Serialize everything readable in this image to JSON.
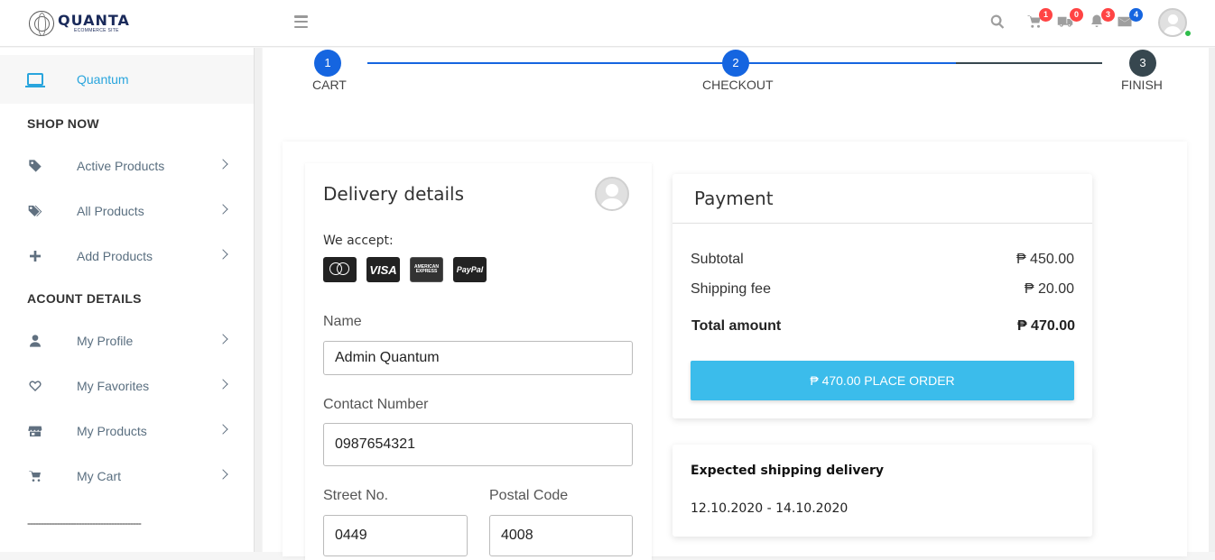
{
  "brand": {
    "name": "QUANTA",
    "tagline": "ECOMMERCE SITE"
  },
  "header": {
    "icons": [
      {
        "name": "search-icon",
        "badge": ""
      },
      {
        "name": "cart-icon",
        "badge": "1"
      },
      {
        "name": "truck-icon",
        "badge": "0"
      },
      {
        "name": "bell-icon",
        "badge": "3"
      },
      {
        "name": "mail-icon",
        "badge": "4"
      }
    ]
  },
  "sidebar": {
    "brand_label": "Quantum",
    "section_shop": "SHOP NOW",
    "shop_items": [
      {
        "label": "Active Products",
        "icon": "tag-icon"
      },
      {
        "label": "All Products",
        "icon": "tags-icon"
      },
      {
        "label": "Add Products",
        "icon": "plus-icon"
      }
    ],
    "section_account": "ACOUNT DETAILS",
    "account_items": [
      {
        "label": "My Profile",
        "icon": "user-icon"
      },
      {
        "label": "My Favorites",
        "icon": "heart-icon"
      },
      {
        "label": "My Products",
        "icon": "store-icon"
      },
      {
        "label": "My Cart",
        "icon": "cart-icon"
      }
    ],
    "divider": "------------------------------------------"
  },
  "stepper": {
    "steps": [
      {
        "num": "1",
        "label": "CART"
      },
      {
        "num": "2",
        "label": "CHECKOUT"
      },
      {
        "num": "3",
        "label": "FINISH"
      }
    ],
    "active_color": "#1565e0",
    "inactive_color": "#37474f"
  },
  "delivery": {
    "title": "Delivery details",
    "accept_label": "We accept:",
    "cards": [
      "mastercard",
      "VISA",
      "AMERICAN EXPRESS",
      "PayPal"
    ],
    "name_label": "Name",
    "name_value": "Admin Quantum",
    "contact_label": "Contact Number",
    "contact_value": "0987654321",
    "street_label": "Street No.",
    "street_value": "0449",
    "postal_label": "Postal Code",
    "postal_value": "4008"
  },
  "payment": {
    "title": "Payment",
    "subtotal_label": "Subtotal",
    "subtotal_value": "₱ 450.00",
    "shipping_label": "Shipping fee",
    "shipping_value": "₱ 20.00",
    "total_label": "Total amount",
    "total_value": "₱ 470.00",
    "button_label": "₱ 470.00 PLACE ORDER"
  },
  "shipping": {
    "title": "Expected shipping delivery",
    "dates": "12.10.2020 - 14.10.2020"
  },
  "colors": {
    "accent": "#29a5dd",
    "button": "#3bbceb",
    "step_active": "#1565e0"
  }
}
